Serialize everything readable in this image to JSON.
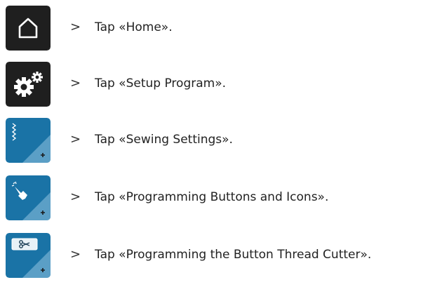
{
  "colors": {
    "dark_button": "#1f1f1f",
    "blue_button": "#1a73a6",
    "text": "#222222"
  },
  "steps": [
    {
      "icon": "home-icon",
      "marker": ">",
      "text": "Tap «Home»."
    },
    {
      "icon": "gears-icon",
      "marker": ">",
      "text": "Tap «Setup Program»."
    },
    {
      "icon": "stitch-settings-icon",
      "marker": ">",
      "text": "Tap «Sewing Settings»."
    },
    {
      "icon": "programming-hand-icon",
      "marker": ">",
      "text": "Tap «Programming Buttons and Icons»."
    },
    {
      "icon": "thread-cutter-icon",
      "marker": ">",
      "text": "Tap «Programming the Button Thread Cutter»."
    }
  ]
}
